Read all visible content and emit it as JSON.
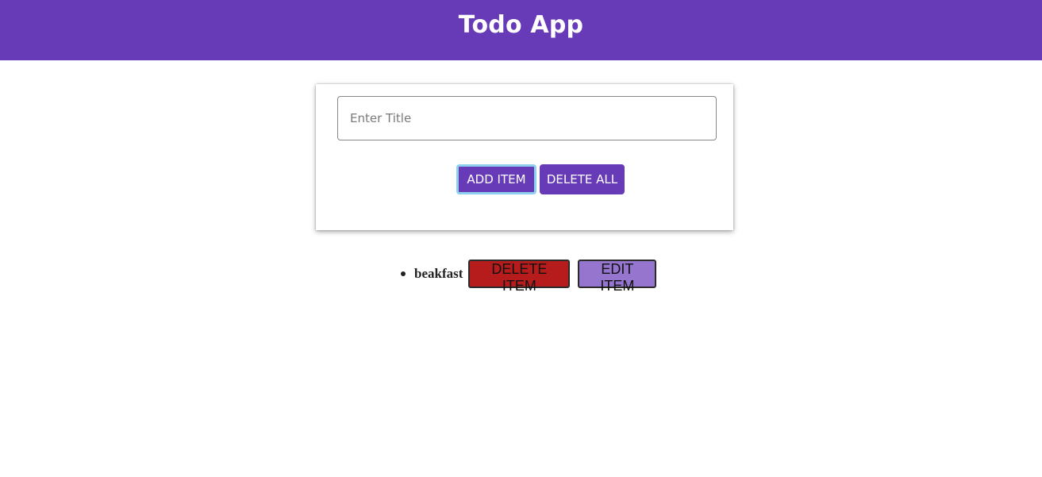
{
  "header": {
    "title": "Todo App"
  },
  "form": {
    "title_input": {
      "placeholder": "Enter Title",
      "value": ""
    },
    "add_button_label": "ADD ITEM",
    "delete_all_button_label": "DELETE ALL"
  },
  "todos": [
    {
      "title": "beakfast",
      "delete_label": "DELETE ITEM",
      "edit_label": "EDIT ITEM"
    }
  ],
  "colors": {
    "header_bg": "#673ab7",
    "primary_button": "#673ab7",
    "focus_ring": "#8fd0ef",
    "delete_item_bg": "#b71c1c",
    "edit_item_bg": "#9575cd"
  }
}
